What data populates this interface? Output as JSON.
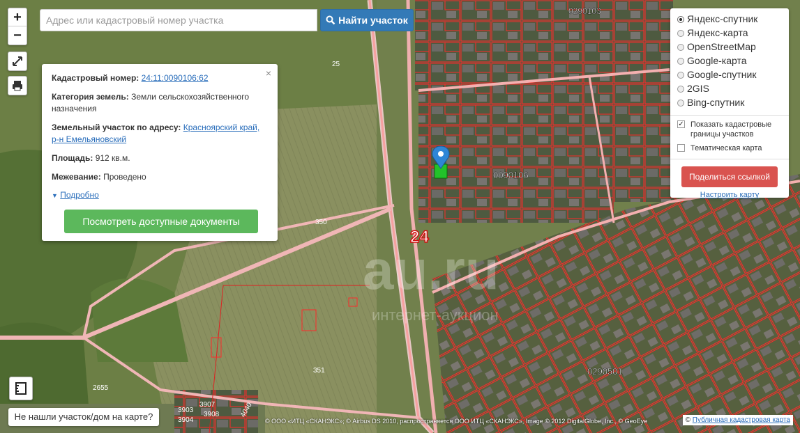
{
  "search": {
    "placeholder": "Адрес или кадастровый номер участка",
    "value": ""
  },
  "search_button": {
    "label": "Найти участок"
  },
  "zoom": {
    "in": "+",
    "out": "−"
  },
  "popup": {
    "cadastral_label": "Кадастровый номер:",
    "cadastral_value": "24:11:0090106:62",
    "category_label": "Категория земель:",
    "category_value": "Земли сельскохозяйственного назначения",
    "address_label": "Земельный участок по адресу:",
    "address_value": "Красноярский край, р-н Емельяновский",
    "area_label": "Площадь:",
    "area_value": "912 кв.м.",
    "survey_label": "Межевание:",
    "survey_value": "Проведено",
    "more_label": "Подробно",
    "docs_button": "Посмотреть доступные документы",
    "close": "×"
  },
  "layers": {
    "options": [
      "Яндекс-спутник",
      "Яндекс-карта",
      "OpenStreetMap",
      "Google-карта",
      "Google-спутник",
      "2GIS",
      "Bing-спутник"
    ],
    "selected": 0,
    "show_borders": "Показать кадастровые границы участков",
    "thematic": "Тематическая карта",
    "share_button": "Поделиться ссылкой",
    "reset_link": "Настроить карту"
  },
  "not_found_button": "Не нашли участок/дом на карте?",
  "map_labels": {
    "quarter_1": "0290103",
    "quarter_2": "0090106",
    "quarter_3": "0290501",
    "road": "24",
    "parcel_25": "25",
    "parcel_350": "350",
    "parcel_351": "351",
    "parcel_2655": "2655",
    "parcel_3907": "3907",
    "parcel_3908": "3908",
    "parcel_3903": "3903",
    "parcel_3904": "3904",
    "parcel_4040": "4040",
    "watermark": "au.ru",
    "watermark_sub": "интернет-аукцион"
  },
  "attribution": "© ООО «ИТЦ «СКАНЭКС»; © Airbus DS 2010, распространяется ООО ИТЦ «СКАНЭКС», Image © 2012 DigitalGlobe, Inc., © GeoEye",
  "attribution_right_prefix": "©",
  "attribution_right_link": "Публичная кадастровая карта",
  "colors": {
    "primary": "#337ab7",
    "success": "#5cb85c",
    "danger": "#d9534f",
    "parcel_border": "#e02020"
  }
}
